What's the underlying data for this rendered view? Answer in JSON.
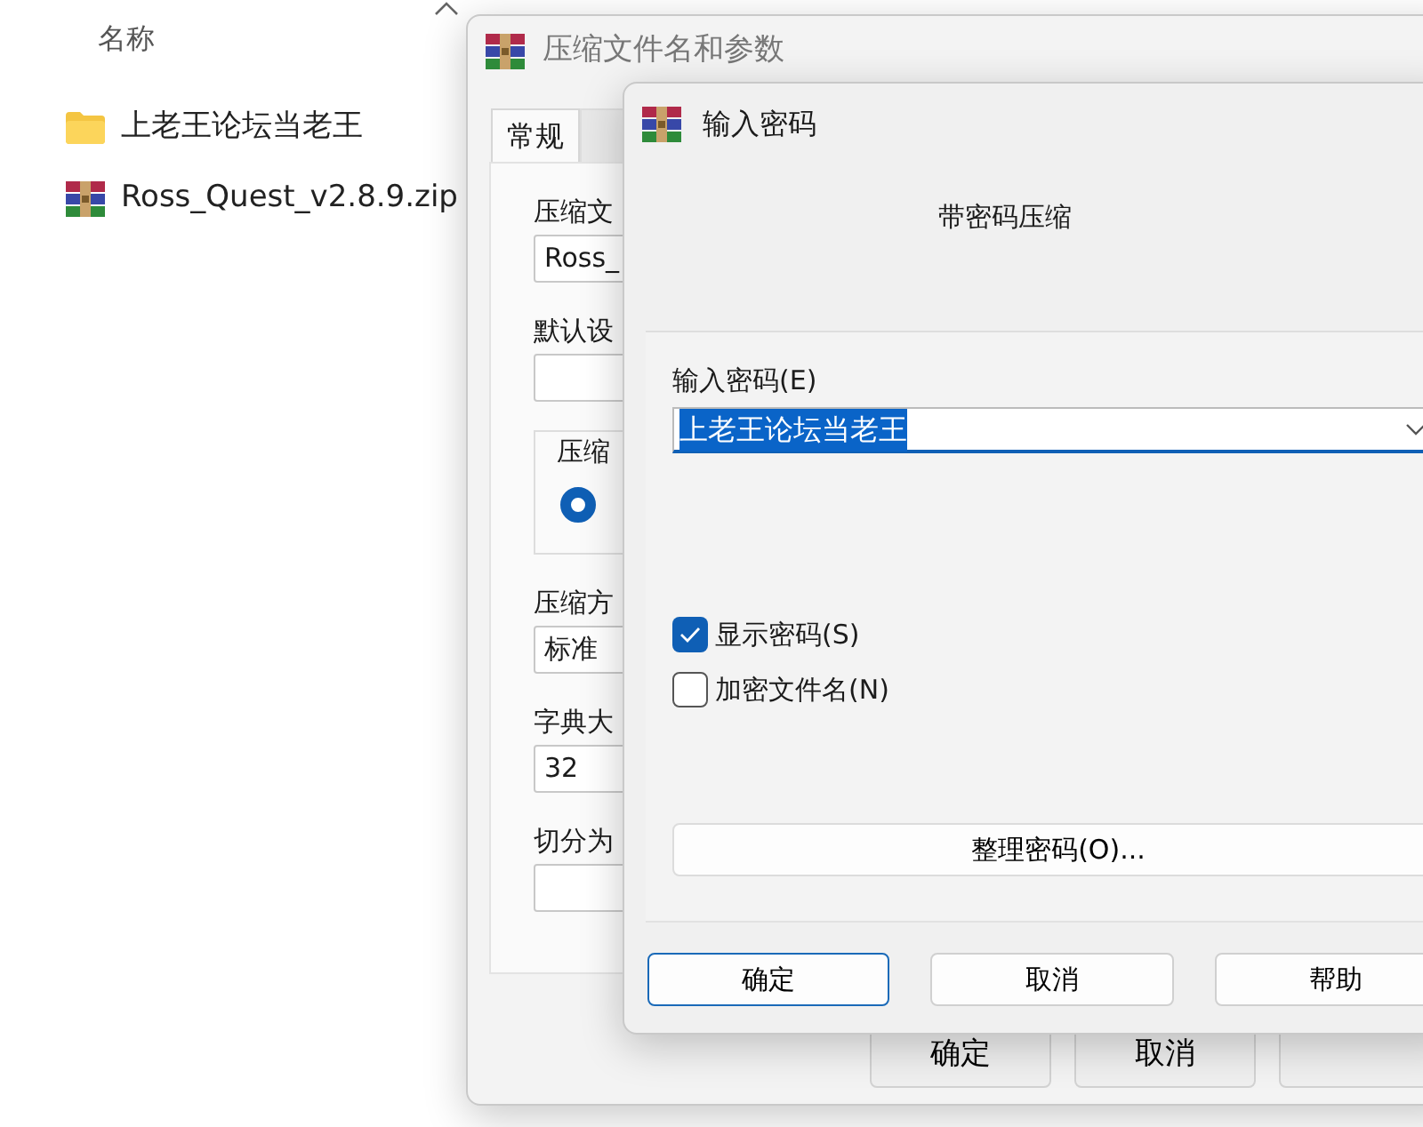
{
  "explorer": {
    "column_header": "名称",
    "items": [
      {
        "kind": "folder",
        "name": "上老王论坛当老王"
      },
      {
        "kind": "archive",
        "name": "Ross_Quest_v2.8.9.zip"
      }
    ]
  },
  "archive_window": {
    "title": "压缩文件名和参数",
    "tabs": [
      {
        "label": "常规",
        "selected": true
      },
      {
        "selected": false
      }
    ],
    "rows": [
      {
        "kind": "field",
        "label": "压缩文",
        "value": "Ross_"
      },
      {
        "kind": "field",
        "label": "默认设"
      },
      {
        "kind": "group",
        "label": "压缩",
        "radio_selected": true
      },
      {
        "kind": "field",
        "label": "压缩方",
        "value": "标准"
      },
      {
        "kind": "field",
        "label": "字典大",
        "value": "32"
      },
      {
        "kind": "field",
        "label": "切分为"
      }
    ],
    "buttons": [
      "确定",
      "取消"
    ]
  },
  "password_dialog": {
    "title": "输入密码",
    "heading": "带密码压缩",
    "password": {
      "label": "输入密码(E)",
      "value": "上老王论坛当老王",
      "text_selected": true
    },
    "checkboxes": [
      {
        "label": "显示密码(S)",
        "checked": true
      },
      {
        "label": "加密文件名(N)",
        "checked": false
      }
    ],
    "manage_button": "整理密码(O)...",
    "buttons": [
      {
        "label": "确定",
        "default": true
      },
      {
        "label": "取消",
        "default": false
      },
      {
        "label": "帮助",
        "default": false
      }
    ]
  }
}
